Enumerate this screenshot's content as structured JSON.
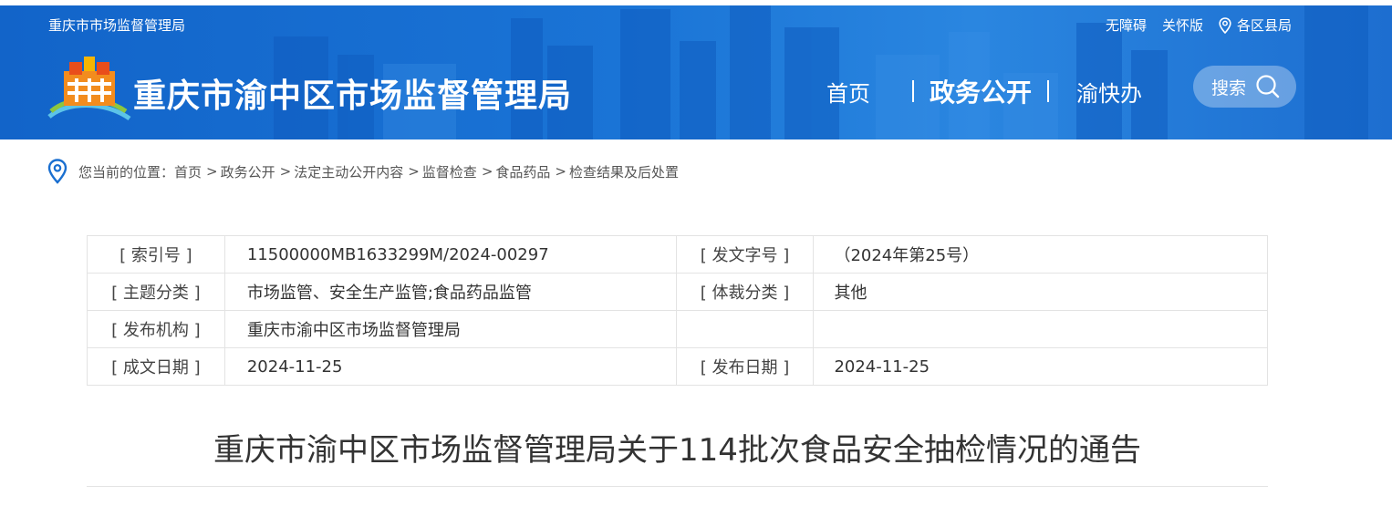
{
  "header": {
    "small_title": "重庆市市场监督管理局",
    "top_links": [
      {
        "label": "无障碍"
      },
      {
        "label": "关怀版"
      },
      {
        "label": "各区县局",
        "icon": "location-pin-icon"
      }
    ],
    "site_title": "重庆市渝中区市场监督管理局",
    "nav": [
      {
        "label": "首页",
        "active": false
      },
      {
        "label": "政务公开",
        "active": true
      },
      {
        "label": "渝快办",
        "active": false
      }
    ],
    "search_label": "搜索",
    "colors": {
      "header_bg": "#1a74d6",
      "text": "#ffffff"
    }
  },
  "breadcrumb": {
    "prefix": "您当前的位置：",
    "items": [
      "首页",
      "政务公开",
      "法定主动公开内容",
      "监督检查",
      "食品药品",
      "检查结果及后处置"
    ],
    "separator": ">"
  },
  "info_table": {
    "rows": [
      {
        "k1": "[ 索引号 ]",
        "v1": "11500000MB1633299M/2024-00297",
        "k2": "[ 发文字号 ]",
        "v2": "（2024年第25号）"
      },
      {
        "k1": "[ 主题分类 ]",
        "v1": "市场监管、安全生产监管;食品药品监管",
        "k2": "[ 体裁分类 ]",
        "v2": "其他"
      },
      {
        "k1": "[ 发布机构 ]",
        "v1": "重庆市渝中区市场监督管理局",
        "k2": "",
        "v2": ""
      },
      {
        "k1": "[ 成文日期 ]",
        "v1": "2024-11-25",
        "k2": "[ 发布日期 ]",
        "v2": "2024-11-25"
      }
    ]
  },
  "article": {
    "title": "重庆市渝中区市场监督管理局关于114批次食品安全抽检情况的通告"
  }
}
